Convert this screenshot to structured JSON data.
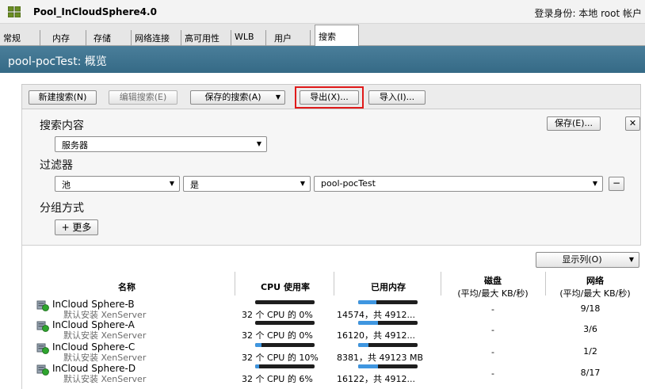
{
  "window": {
    "title": "Pool_InCloudSphere4.0",
    "login_info": "登录身份: 本地 root 帐户"
  },
  "tabs": [
    "常规",
    "内存",
    "存储",
    "网络连接",
    "高可用性",
    "WLB",
    "用户",
    "搜索"
  ],
  "active_tab": "搜索",
  "header": {
    "title": "pool-pocTest: 概览"
  },
  "toolbar": {
    "new_search": "新建搜索(N)",
    "edit_search": "编辑搜索(E)",
    "saved_searches": "保存的搜索(A)",
    "export": "导出(X)...",
    "import": "导入(I)..."
  },
  "search": {
    "content_label": "搜索内容",
    "content_value": "服务器",
    "save_button": "保存(E)...",
    "close_glyph": "✕",
    "filter_label": "过滤器",
    "filter_field": "池",
    "filter_operator": "是",
    "filter_value": "pool-pocTest",
    "remove_glyph": "−",
    "group_label": "分组方式",
    "more_button": "+ 更多"
  },
  "results": {
    "columns_button": "显示列(O)",
    "headers": {
      "name": "名称",
      "cpu": "CPU 使用率",
      "memory": "已用内存",
      "disk_title": "磁盘",
      "disk_sub": "(平均/最大 KB/秒)",
      "network_title": "网络",
      "network_sub": "(平均/最大 KB/秒)"
    },
    "rows": [
      {
        "name": "InCloud Sphere-B",
        "sub": "默认安装 XenServer",
        "cpu_text": "32 个 CPU 的 0%",
        "cpu_pct": 0,
        "mem_text": "14574，共 4912...",
        "mem_pct": 30,
        "disk": "-",
        "network": "9/18"
      },
      {
        "name": "InCloud Sphere-A",
        "sub": "默认安装 XenServer",
        "cpu_text": "32 个 CPU 的 0%",
        "cpu_pct": 0,
        "mem_text": "16120，共 4912...",
        "mem_pct": 33,
        "disk": "-",
        "network": "3/6"
      },
      {
        "name": "InCloud Sphere-C",
        "sub": "默认安装 XenServer",
        "cpu_text": "32 个 CPU 的 10%",
        "cpu_pct": 10,
        "mem_text": "8381，共 49123 MB",
        "mem_pct": 17,
        "disk": "-",
        "network": "1/2"
      },
      {
        "name": "InCloud Sphere-D",
        "sub": "默认安装 XenServer",
        "cpu_text": "32 个 CPU 的 6%",
        "cpu_pct": 6,
        "mem_text": "16122，共 4912...",
        "mem_pct": 33,
        "disk": "-",
        "network": "8/17"
      }
    ]
  },
  "colors": {
    "header_bg": "#3f7491",
    "bar_fill": "#3f96e0",
    "bar_track": "#1e1e1e",
    "highlight": "#e01a1a"
  }
}
